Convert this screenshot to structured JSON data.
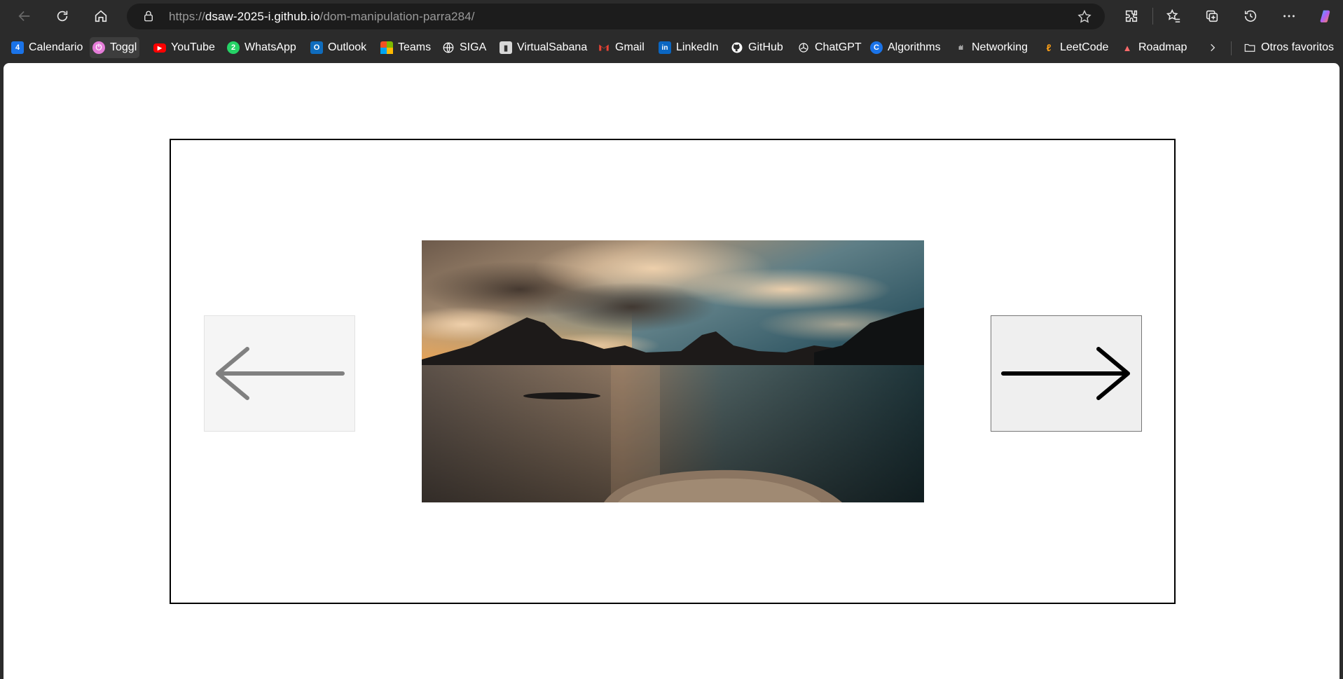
{
  "browser": {
    "url_scheme": "https://",
    "url_host": "dsaw-2025-i.github.io",
    "url_path": "/dom-manipulation-parra284/",
    "accent": "#1a73e8"
  },
  "bookmarks": [
    {
      "label": "Calendario",
      "icon": "calendar-icon",
      "color": "#1a73e8"
    },
    {
      "label": "Toggl",
      "icon": "toggl-icon",
      "color": "#e57cd8"
    },
    {
      "label": "YouTube",
      "icon": "youtube-icon",
      "color": "#ff0000"
    },
    {
      "label": "WhatsApp",
      "icon": "whatsapp-icon",
      "color": "#25d366"
    },
    {
      "label": "Outlook",
      "icon": "outlook-icon",
      "color": "#0f6cbd"
    },
    {
      "label": "Teams",
      "icon": "teams-icon",
      "color": "#ffb900"
    },
    {
      "label": "SIGA",
      "icon": "globe-icon",
      "color": "#ffffff"
    },
    {
      "label": "VirtualSabana",
      "icon": "virtualsabana-icon",
      "color": "#cccccc"
    },
    {
      "label": "Gmail",
      "icon": "gmail-icon",
      "color": "#ea4335"
    },
    {
      "label": "LinkedIn",
      "icon": "linkedin-icon",
      "color": "#0a66c2"
    },
    {
      "label": "GitHub",
      "icon": "github-icon",
      "color": "#ffffff"
    },
    {
      "label": "ChatGPT",
      "icon": "chatgpt-icon",
      "color": "#ffffff"
    },
    {
      "label": "Algorithms",
      "icon": "algorithms-icon",
      "color": "#1a73e8"
    },
    {
      "label": "Networking",
      "icon": "cisco-icon",
      "color": "#aaaaaa"
    },
    {
      "label": "LeetCode",
      "icon": "leetcode-icon",
      "color": "#ffa116"
    },
    {
      "label": "Roadmap",
      "icon": "roadmap-icon",
      "color": "#ff6b6b"
    }
  ],
  "other_favorites": "Otros favoritos",
  "carousel": {
    "prev_icon": "arrow-left-icon",
    "next_icon": "arrow-right-icon",
    "image_icon": "mountain-lake-sunset-image"
  }
}
